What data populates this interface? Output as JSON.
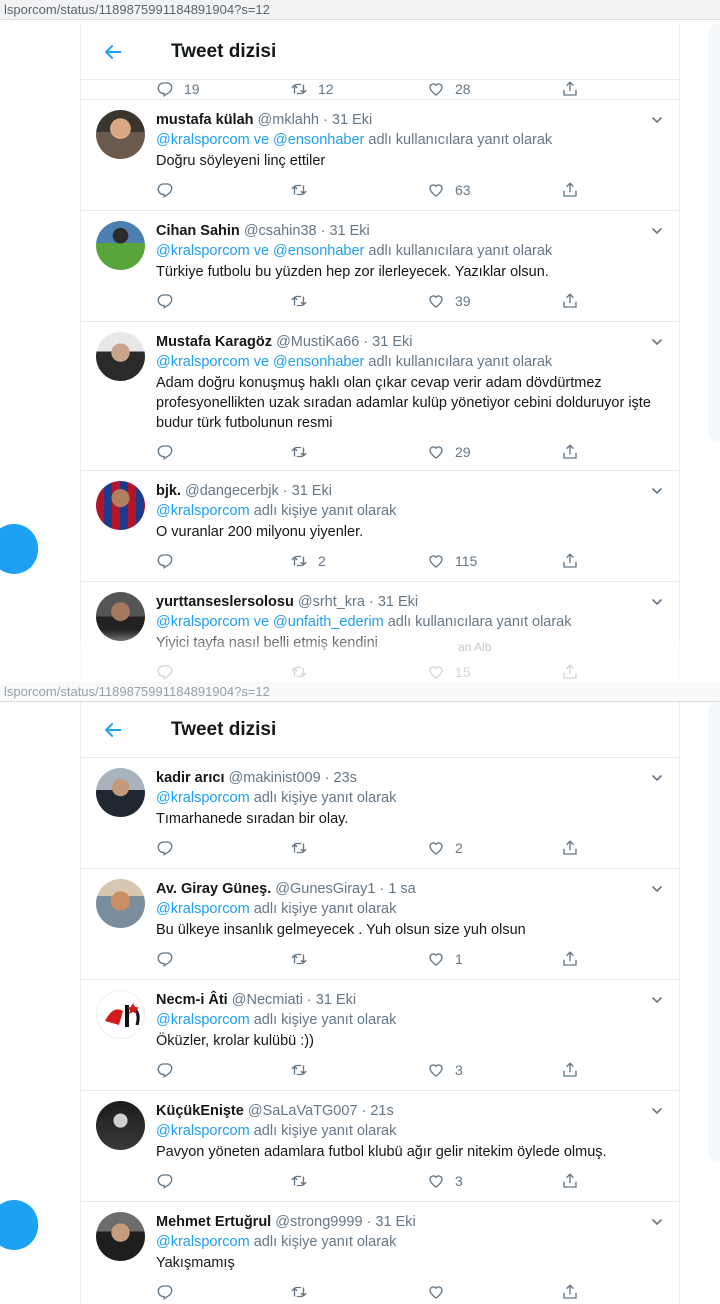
{
  "shot1": {
    "url": "lsporcom/status/1189875991184891904?s=12",
    "header_title": "Tweet dizisi",
    "partial_counts": [
      "19",
      "12",
      "28"
    ],
    "tweets": [
      {
        "name": "mustafa külah",
        "handle": "@mklahh",
        "date": "· 31 Eki",
        "reply_prefix": "",
        "mention1": "@kralsporcom ve @ensonhaber",
        "mention2": "",
        "reply_suffix": " adlı kullanıcılara yanıt olarak",
        "text": "Doğru söyleyeni linç ettiler",
        "replies": "",
        "retweets": "",
        "likes": "63"
      },
      {
        "name": "Cihan Sahin",
        "handle": "@csahin38",
        "date": "· 31 Eki",
        "mention1": "@kralsporcom ve @ensonhaber",
        "mention2": "",
        "reply_suffix": " adlı kullanıcılara yanıt olarak",
        "text": "Türkiye futbolu bu yüzden hep zor ilerleyecek. Yazıklar olsun.",
        "replies": "",
        "retweets": "",
        "likes": "39"
      },
      {
        "name": "Mustafa Karagöz",
        "handle": "@MustiKa66",
        "date": "· 31 Eki",
        "mention1": "@kralsporcom ve @ensonhaber",
        "mention2": "",
        "reply_suffix": " adlı kullanıcılara yanıt olarak",
        "text": "Adam doğru konuşmuş haklı olan çıkar cevap verir adam dövdürtmez profesyonellikten uzak sıradan adamlar kulüp yönetiyor cebini dolduruyor işte budur türk futbolunun resmi",
        "replies": "",
        "retweets": "",
        "likes": "29"
      },
      {
        "name": "bjk.",
        "handle": "@dangecerbjk",
        "date": "· 31 Eki",
        "mention1": "@kralsporcom",
        "mention2": "",
        "reply_suffix": " adlı kişiye yanıt olarak",
        "text": "O vuranlar 200 milyonu yiyenler.",
        "replies": "",
        "retweets": "2",
        "likes": "115"
      },
      {
        "name": "yurttanseslersolosu",
        "handle": "@srht_kra",
        "date": "· 31 Eki",
        "mention1": "@kralsporcom ve @unfaith_ederim",
        "mention2": "",
        "reply_suffix": " adlı kullanıcılara yanıt olarak",
        "text": "Yiyici tayfa nasıl belli etmiş kendini",
        "replies": "",
        "retweets": "",
        "likes": "15"
      }
    ],
    "overlay_text": "an Alb"
  },
  "shot2": {
    "url": "lsporcom/status/1189875991184891904?s=12",
    "header_title": "Tweet dizisi",
    "tweets": [
      {
        "name": "kadir arıcı",
        "handle": "@makinist009",
        "date": "· 23s",
        "mention1": "@kralsporcom",
        "reply_suffix": " adlı kişiye yanıt olarak",
        "text": "Tımarhanede sıradan bir olay.",
        "replies": "",
        "retweets": "",
        "likes": "2"
      },
      {
        "name": "Av. Giray Güneş.",
        "handle": "@GunesGiray1",
        "date": "· 1 sa",
        "mention1": "@kralsporcom",
        "reply_suffix": " adlı kişiye yanıt olarak",
        "text": "Bu ülkeye insanlık gelmeyecek . Yuh olsun size yuh olsun",
        "replies": "",
        "retweets": "",
        "likes": "1"
      },
      {
        "name": "Necm-i Âti",
        "handle": "@Necmiati",
        "date": "· 31 Eki",
        "mention1": "@kralsporcom",
        "reply_suffix": " adlı kişiye yanıt olarak",
        "text": "Öküzler, krolar kulübü :))",
        "replies": "",
        "retweets": "",
        "likes": "3"
      },
      {
        "name": "KüçükEnişte",
        "handle": "@SaLaVaTG007",
        "date": "· 21s",
        "mention1": "@kralsporcom",
        "reply_suffix": " adlı kişiye yanıt olarak",
        "text": "Pavyon yöneten adamlara futbol klubü ağır gelir nitekim öylede olmuş.",
        "replies": "",
        "retweets": "",
        "likes": "3"
      },
      {
        "name": "Mehmet Ertuğrul",
        "handle": "@strong9999",
        "date": "· 31 Eki",
        "mention1": "@kralsporcom",
        "reply_suffix": " adlı kişiye yanıt olarak",
        "text": "Yakışmamış",
        "replies": "",
        "retweets": "",
        "likes": ""
      }
    ]
  },
  "colors": {
    "accent": "#1da1f2",
    "muted": "#657786",
    "border": "#e6ecf0",
    "text": "#14171a"
  },
  "icons": [
    "back-arrow-icon",
    "reply-icon",
    "retweet-icon",
    "like-icon",
    "share-icon",
    "chevron-down-icon"
  ]
}
